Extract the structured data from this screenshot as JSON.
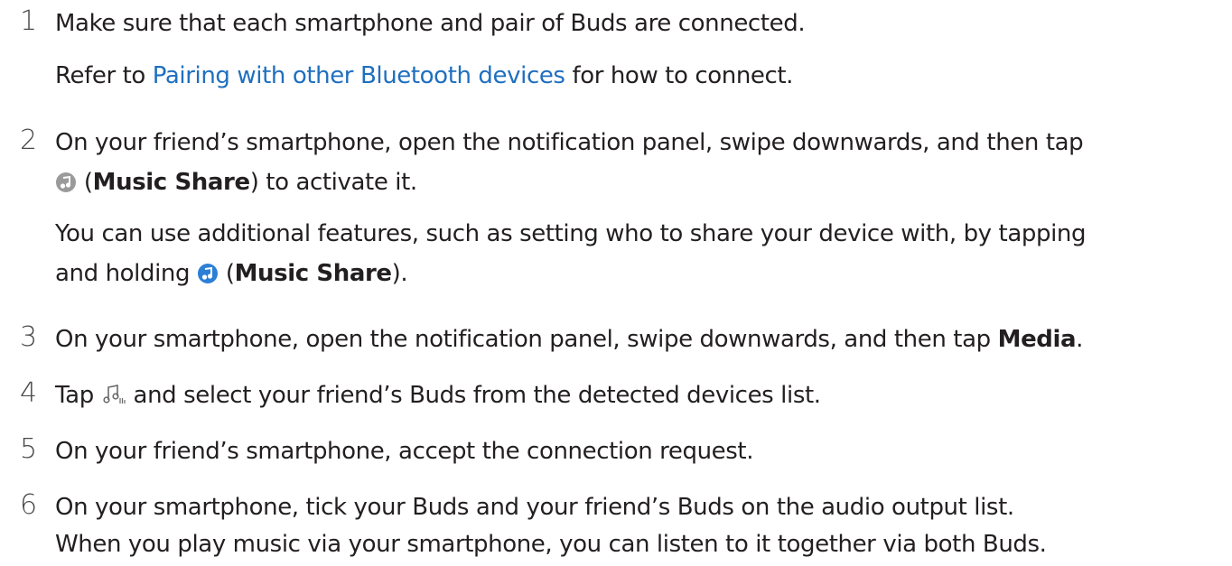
{
  "steps": [
    {
      "number": "1",
      "line1": "Make sure that each smartphone and pair of Buds are connected.",
      "line2_before": "Refer to ",
      "line2_link": "Pairing with other Bluetooth devices",
      "line2_after": " for how to connect."
    },
    {
      "number": "2",
      "line1": "On your friend’s smartphone, open the notification panel, swipe downwards, and then tap",
      "line2_open": " (",
      "line2_bold": "Music Share",
      "line2_after": ") to activate it.",
      "line3": "You can use additional features, such as setting who to share your device with, by tapping",
      "line4_before": "and holding ",
      "line4_open": " (",
      "line4_bold": "Music Share",
      "line4_after": ")."
    },
    {
      "number": "3",
      "line1_before": "On your smartphone, open the notification panel, swipe downwards, and then tap ",
      "line1_bold": "Media",
      "line1_after": "."
    },
    {
      "number": "4",
      "line1_before": "Tap ",
      "line1_after": " and select your friend’s Buds from the detected devices list."
    },
    {
      "number": "5",
      "line1": "On your friend’s smartphone, accept the connection request."
    },
    {
      "number": "6",
      "line1": "On your smartphone, tick your Buds and your friend’s Buds on the audio output list.",
      "line2": "When you play music via your smartphone, you can listen to it together via both Buds."
    }
  ],
  "colors": {
    "text": "#231f20",
    "link": "#1f6fbf",
    "icon_gray": "#9a9a9a",
    "icon_blue": "#2b7fd6"
  },
  "icons": {
    "music_share_off": "music-share-off-icon",
    "music_share_on": "music-share-on-icon",
    "audio_output": "audio-output-icon"
  }
}
